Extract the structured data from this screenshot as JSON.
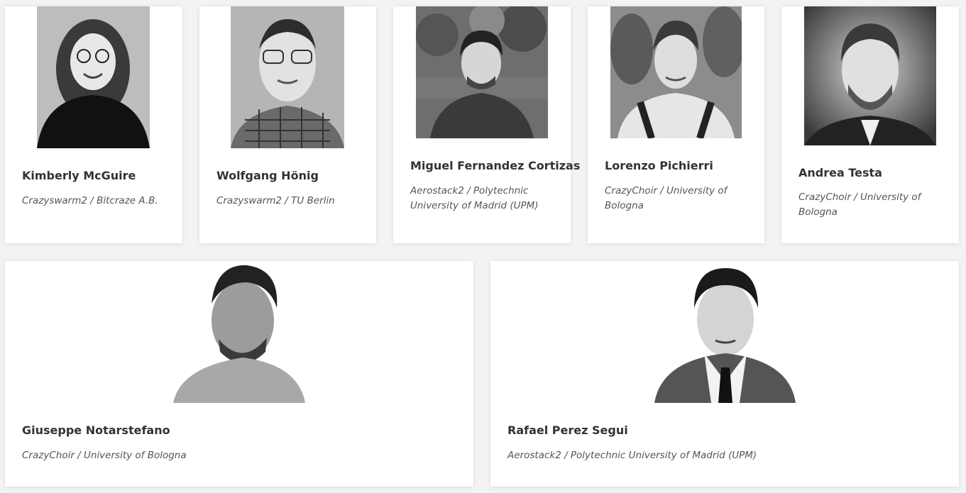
{
  "people": [
    {
      "name": "Kimberly McGuire",
      "affiliation": "Crazyswarm2 / Bitcraze A.B."
    },
    {
      "name": "Wolfgang Hönig",
      "affiliation": "Crazyswarm2 / TU Berlin"
    },
    {
      "name": "Miguel Fernandez Cortizas",
      "affiliation": "Aerostack2 / Polytechnic University of Madrid (UPM)"
    },
    {
      "name": "Lorenzo Pichierri",
      "affiliation": "CrazyChoir / University of Bologna"
    },
    {
      "name": "Andrea Testa",
      "affiliation": "CrazyChoir / University of Bologna"
    },
    {
      "name": "Giuseppe Notarstefano",
      "affiliation": "CrazyChoir / University of Bologna"
    },
    {
      "name": "Rafael Perez Segui",
      "affiliation": "Aerostack2 / Polytechnic University of Madrid (UPM)"
    }
  ]
}
